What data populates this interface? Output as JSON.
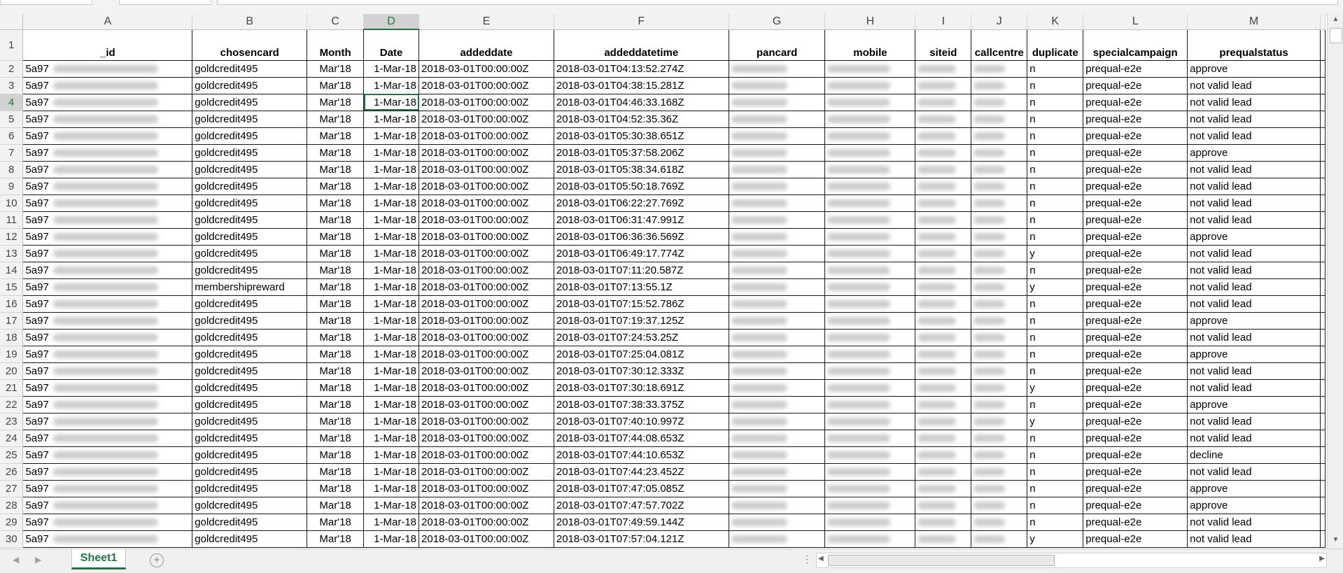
{
  "sheet": {
    "active_tab": "Sheet1",
    "columns": [
      "A",
      "B",
      "C",
      "D",
      "E",
      "F",
      "G",
      "H",
      "I",
      "J",
      "K",
      "L",
      "M"
    ],
    "selected_column": "D",
    "selected_row": "4",
    "headers": [
      "_id",
      "chosencard",
      "Month",
      "Date",
      "addeddate",
      "addeddatetime",
      "pancard",
      "mobile",
      "siteid",
      "callcentre",
      "duplicate",
      "specialcampaign",
      "prequalstatus"
    ],
    "rows": [
      {
        "num": "2",
        "id": "5a97",
        "card": "goldcredit495",
        "month": "Mar'18",
        "date": "1-Mar-18",
        "addeddate": "2018-03-01T00:00:00Z",
        "addeddatetime": "2018-03-01T04:13:52.274Z",
        "dup": "n",
        "campaign": "prequal-e2e",
        "status": "approve"
      },
      {
        "num": "3",
        "id": "5a97",
        "card": "goldcredit495",
        "month": "Mar'18",
        "date": "1-Mar-18",
        "addeddate": "2018-03-01T00:00:00Z",
        "addeddatetime": "2018-03-01T04:38:15.281Z",
        "dup": "n",
        "campaign": "prequal-e2e",
        "status": "not valid lead"
      },
      {
        "num": "4",
        "id": "5a97",
        "card": "goldcredit495",
        "month": "Mar'18",
        "date": "1-Mar-18",
        "addeddate": "2018-03-01T00:00:00Z",
        "addeddatetime": "2018-03-01T04:46:33.168Z",
        "dup": "n",
        "campaign": "prequal-e2e",
        "status": "not valid lead"
      },
      {
        "num": "5",
        "id": "5a97",
        "card": "goldcredit495",
        "month": "Mar'18",
        "date": "1-Mar-18",
        "addeddate": "2018-03-01T00:00:00Z",
        "addeddatetime": "2018-03-01T04:52:35.36Z",
        "dup": "n",
        "campaign": "prequal-e2e",
        "status": "not valid lead"
      },
      {
        "num": "6",
        "id": "5a97",
        "card": "goldcredit495",
        "month": "Mar'18",
        "date": "1-Mar-18",
        "addeddate": "2018-03-01T00:00:00Z",
        "addeddatetime": "2018-03-01T05:30:38.651Z",
        "dup": "n",
        "campaign": "prequal-e2e",
        "status": "not valid lead"
      },
      {
        "num": "7",
        "id": "5a97",
        "card": "goldcredit495",
        "month": "Mar'18",
        "date": "1-Mar-18",
        "addeddate": "2018-03-01T00:00:00Z",
        "addeddatetime": "2018-03-01T05:37:58.206Z",
        "dup": "n",
        "campaign": "prequal-e2e",
        "status": "approve"
      },
      {
        "num": "8",
        "id": "5a97",
        "card": "goldcredit495",
        "month": "Mar'18",
        "date": "1-Mar-18",
        "addeddate": "2018-03-01T00:00:00Z",
        "addeddatetime": "2018-03-01T05:38:34.618Z",
        "dup": "n",
        "campaign": "prequal-e2e",
        "status": "not valid lead"
      },
      {
        "num": "9",
        "id": "5a97",
        "card": "goldcredit495",
        "month": "Mar'18",
        "date": "1-Mar-18",
        "addeddate": "2018-03-01T00:00:00Z",
        "addeddatetime": "2018-03-01T05:50:18.769Z",
        "dup": "n",
        "campaign": "prequal-e2e",
        "status": "not valid lead"
      },
      {
        "num": "10",
        "id": "5a97",
        "card": "goldcredit495",
        "month": "Mar'18",
        "date": "1-Mar-18",
        "addeddate": "2018-03-01T00:00:00Z",
        "addeddatetime": "2018-03-01T06:22:27.769Z",
        "dup": "n",
        "campaign": "prequal-e2e",
        "status": "not valid lead"
      },
      {
        "num": "11",
        "id": "5a97",
        "card": "goldcredit495",
        "month": "Mar'18",
        "date": "1-Mar-18",
        "addeddate": "2018-03-01T00:00:00Z",
        "addeddatetime": "2018-03-01T06:31:47.991Z",
        "dup": "n",
        "campaign": "prequal-e2e",
        "status": "not valid lead"
      },
      {
        "num": "12",
        "id": "5a97",
        "card": "goldcredit495",
        "month": "Mar'18",
        "date": "1-Mar-18",
        "addeddate": "2018-03-01T00:00:00Z",
        "addeddatetime": "2018-03-01T06:36:36.569Z",
        "dup": "n",
        "campaign": "prequal-e2e",
        "status": "approve"
      },
      {
        "num": "13",
        "id": "5a97",
        "card": "goldcredit495",
        "month": "Mar'18",
        "date": "1-Mar-18",
        "addeddate": "2018-03-01T00:00:00Z",
        "addeddatetime": "2018-03-01T06:49:17.774Z",
        "dup": "y",
        "campaign": "prequal-e2e",
        "status": "not valid lead"
      },
      {
        "num": "14",
        "id": "5a97",
        "card": "goldcredit495",
        "month": "Mar'18",
        "date": "1-Mar-18",
        "addeddate": "2018-03-01T00:00:00Z",
        "addeddatetime": "2018-03-01T07:11:20.587Z",
        "dup": "n",
        "campaign": "prequal-e2e",
        "status": "not valid lead"
      },
      {
        "num": "15",
        "id": "5a97",
        "card": "membershipreward",
        "month": "Mar'18",
        "date": "1-Mar-18",
        "addeddate": "2018-03-01T00:00:00Z",
        "addeddatetime": "2018-03-01T07:13:55.1Z",
        "dup": "y",
        "campaign": "prequal-e2e",
        "status": "not valid lead"
      },
      {
        "num": "16",
        "id": "5a97",
        "card": "goldcredit495",
        "month": "Mar'18",
        "date": "1-Mar-18",
        "addeddate": "2018-03-01T00:00:00Z",
        "addeddatetime": "2018-03-01T07:15:52.786Z",
        "dup": "n",
        "campaign": "prequal-e2e",
        "status": "not valid lead"
      },
      {
        "num": "17",
        "id": "5a97",
        "card": "goldcredit495",
        "month": "Mar'18",
        "date": "1-Mar-18",
        "addeddate": "2018-03-01T00:00:00Z",
        "addeddatetime": "2018-03-01T07:19:37.125Z",
        "dup": "n",
        "campaign": "prequal-e2e",
        "status": "approve"
      },
      {
        "num": "18",
        "id": "5a97",
        "card": "goldcredit495",
        "month": "Mar'18",
        "date": "1-Mar-18",
        "addeddate": "2018-03-01T00:00:00Z",
        "addeddatetime": "2018-03-01T07:24:53.25Z",
        "dup": "n",
        "campaign": "prequal-e2e",
        "status": "not valid lead"
      },
      {
        "num": "19",
        "id": "5a97",
        "card": "goldcredit495",
        "month": "Mar'18",
        "date": "1-Mar-18",
        "addeddate": "2018-03-01T00:00:00Z",
        "addeddatetime": "2018-03-01T07:25:04.081Z",
        "dup": "n",
        "campaign": "prequal-e2e",
        "status": "approve"
      },
      {
        "num": "20",
        "id": "5a97",
        "card": "goldcredit495",
        "month": "Mar'18",
        "date": "1-Mar-18",
        "addeddate": "2018-03-01T00:00:00Z",
        "addeddatetime": "2018-03-01T07:30:12.333Z",
        "dup": "n",
        "campaign": "prequal-e2e",
        "status": "not valid lead"
      },
      {
        "num": "21",
        "id": "5a97",
        "card": "goldcredit495",
        "month": "Mar'18",
        "date": "1-Mar-18",
        "addeddate": "2018-03-01T00:00:00Z",
        "addeddatetime": "2018-03-01T07:30:18.691Z",
        "dup": "y",
        "campaign": "prequal-e2e",
        "status": "not valid lead"
      },
      {
        "num": "22",
        "id": "5a97",
        "card": "goldcredit495",
        "month": "Mar'18",
        "date": "1-Mar-18",
        "addeddate": "2018-03-01T00:00:00Z",
        "addeddatetime": "2018-03-01T07:38:33.375Z",
        "dup": "n",
        "campaign": "prequal-e2e",
        "status": "approve"
      },
      {
        "num": "23",
        "id": "5a97",
        "card": "goldcredit495",
        "month": "Mar'18",
        "date": "1-Mar-18",
        "addeddate": "2018-03-01T00:00:00Z",
        "addeddatetime": "2018-03-01T07:40:10.997Z",
        "dup": "y",
        "campaign": "prequal-e2e",
        "status": "not valid lead"
      },
      {
        "num": "24",
        "id": "5a97",
        "card": "goldcredit495",
        "month": "Mar'18",
        "date": "1-Mar-18",
        "addeddate": "2018-03-01T00:00:00Z",
        "addeddatetime": "2018-03-01T07:44:08.653Z",
        "dup": "n",
        "campaign": "prequal-e2e",
        "status": "not valid lead"
      },
      {
        "num": "25",
        "id": "5a97",
        "card": "goldcredit495",
        "month": "Mar'18",
        "date": "1-Mar-18",
        "addeddate": "2018-03-01T00:00:00Z",
        "addeddatetime": "2018-03-01T07:44:10.653Z",
        "dup": "n",
        "campaign": "prequal-e2e",
        "status": "decline"
      },
      {
        "num": "26",
        "id": "5a97",
        "card": "goldcredit495",
        "month": "Mar'18",
        "date": "1-Mar-18",
        "addeddate": "2018-03-01T00:00:00Z",
        "addeddatetime": "2018-03-01T07:44:23.452Z",
        "dup": "n",
        "campaign": "prequal-e2e",
        "status": "not valid lead"
      },
      {
        "num": "27",
        "id": "5a97",
        "card": "goldcredit495",
        "month": "Mar'18",
        "date": "1-Mar-18",
        "addeddate": "2018-03-01T00:00:00Z",
        "addeddatetime": "2018-03-01T07:47:05.085Z",
        "dup": "n",
        "campaign": "prequal-e2e",
        "status": "approve"
      },
      {
        "num": "28",
        "id": "5a97",
        "card": "goldcredit495",
        "month": "Mar'18",
        "date": "1-Mar-18",
        "addeddate": "2018-03-01T00:00:00Z",
        "addeddatetime": "2018-03-01T07:47:57.702Z",
        "dup": "n",
        "campaign": "prequal-e2e",
        "status": "approve"
      },
      {
        "num": "29",
        "id": "5a97",
        "card": "goldcredit495",
        "month": "Mar'18",
        "date": "1-Mar-18",
        "addeddate": "2018-03-01T00:00:00Z",
        "addeddatetime": "2018-03-01T07:49:59.144Z",
        "dup": "n",
        "campaign": "prequal-e2e",
        "status": "not valid lead"
      },
      {
        "num": "30",
        "id": "5a97",
        "card": "goldcredit495",
        "month": "Mar'18",
        "date": "1-Mar-18",
        "addeddate": "2018-03-01T00:00:00Z",
        "addeddatetime": "2018-03-01T07:57:04.121Z",
        "dup": "y",
        "campaign": "prequal-e2e",
        "status": "not valid lead"
      }
    ]
  },
  "ui": {
    "header_row_num": "1",
    "add_sheet_glyph": "+",
    "accent_color": "#217346"
  }
}
